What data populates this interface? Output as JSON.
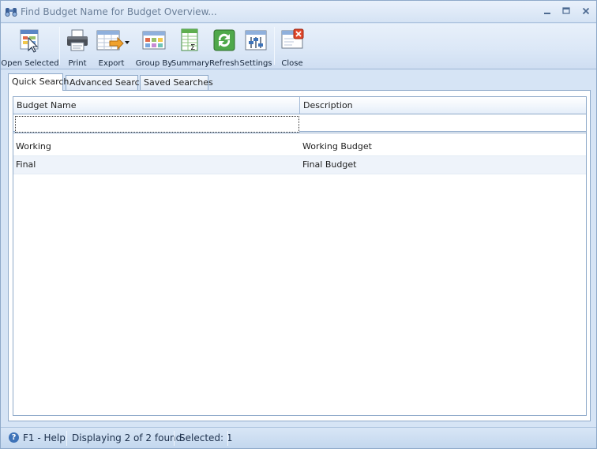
{
  "window": {
    "title": "Find Budget Name for Budget Overview...",
    "icon": "binoculars-icon"
  },
  "toolbar": {
    "open_selected": "Open Selected",
    "print": "Print",
    "export": "Export",
    "group_by": "Group By",
    "summary": "Summary",
    "refresh": "Refresh",
    "settings": "Settings",
    "close": "Close"
  },
  "tabs": [
    {
      "label": "Quick Search",
      "active": true
    },
    {
      "label": "Advanced Search",
      "active": false
    },
    {
      "label": "Saved Searches",
      "active": false
    }
  ],
  "grid": {
    "columns": [
      "Budget Name",
      "Description"
    ],
    "filter": {
      "budget_name": "",
      "description": ""
    },
    "rows": [
      {
        "budget_name": "Working",
        "description": "Working Budget"
      },
      {
        "budget_name": "Final",
        "description": "Final Budget"
      }
    ]
  },
  "status": {
    "help": "F1 - Help",
    "displaying": "Displaying 2 of 2 found",
    "selected": "Selected: 1"
  },
  "colors": {
    "accent": "#3e73b8",
    "border": "#8ea9c9",
    "ribbon": "#dce8f7"
  }
}
